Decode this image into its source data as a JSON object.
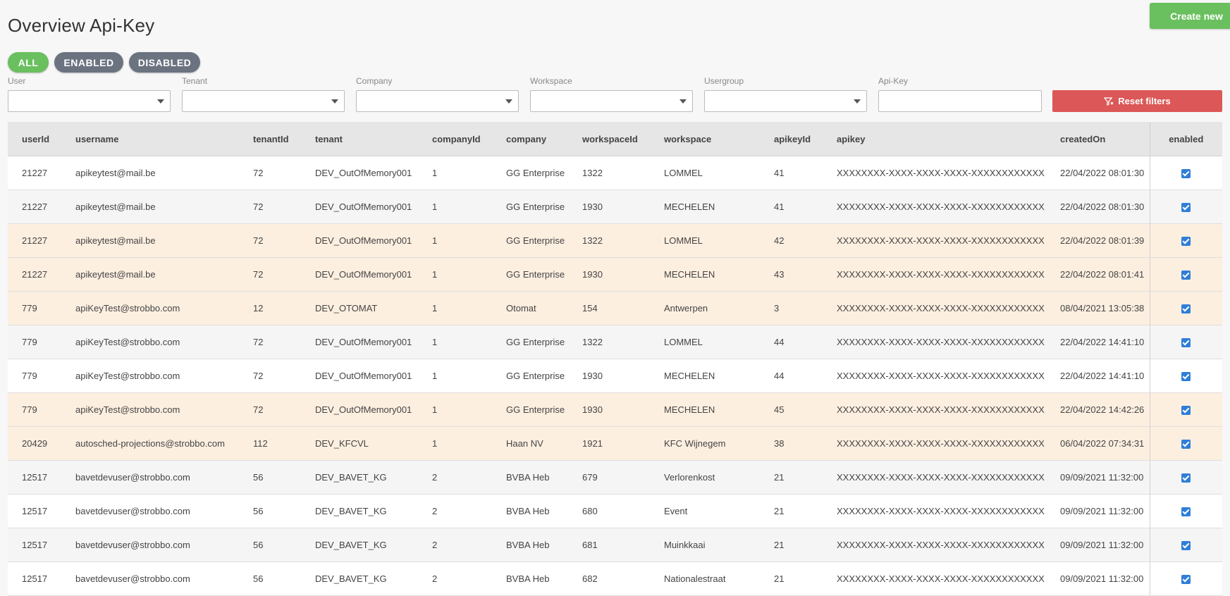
{
  "header": {
    "title": "Overview Api-Key",
    "create_label": "Create new"
  },
  "status_filters": {
    "all": "ALL",
    "enabled": "ENABLED",
    "disabled": "DISABLED"
  },
  "filters": {
    "user": {
      "label": "User",
      "value": ""
    },
    "tenant": {
      "label": "Tenant",
      "value": ""
    },
    "company": {
      "label": "Company",
      "value": ""
    },
    "workspace": {
      "label": "Workspace",
      "value": ""
    },
    "usergroup": {
      "label": "Usergroup",
      "value": ""
    },
    "apikey": {
      "label": "Api-Key",
      "value": ""
    },
    "reset_label": "Reset filters"
  },
  "table": {
    "columns": [
      "userId",
      "username",
      "tenantId",
      "tenant",
      "companyId",
      "company",
      "workspaceId",
      "workspace",
      "apikeyId",
      "apikey",
      "createdOn",
      "enabled"
    ],
    "rows": [
      {
        "userId": "21227",
        "username": "apikeytest@mail.be",
        "tenantId": "72",
        "tenant": "DEV_OutOfMemory001",
        "companyId": "1",
        "company": "GG Enterprise",
        "workspaceId": "1322",
        "workspace": "LOMMEL",
        "apikeyId": "41",
        "apikey": "XXXXXXXX-XXXX-XXXX-XXXX-XXXXXXXXXXXX",
        "createdOn": "22/04/2022 08:01:30",
        "enabled": true,
        "style": "plain"
      },
      {
        "userId": "21227",
        "username": "apikeytest@mail.be",
        "tenantId": "72",
        "tenant": "DEV_OutOfMemory001",
        "companyId": "1",
        "company": "GG Enterprise",
        "workspaceId": "1930",
        "workspace": "MECHELEN",
        "apikeyId": "41",
        "apikey": "XXXXXXXX-XXXX-XXXX-XXXX-XXXXXXXXXXXX",
        "createdOn": "22/04/2022 08:01:30",
        "enabled": true,
        "style": "alt"
      },
      {
        "userId": "21227",
        "username": "apikeytest@mail.be",
        "tenantId": "72",
        "tenant": "DEV_OutOfMemory001",
        "companyId": "1",
        "company": "GG Enterprise",
        "workspaceId": "1322",
        "workspace": "LOMMEL",
        "apikeyId": "42",
        "apikey": "XXXXXXXX-XXXX-XXXX-XXXX-XXXXXXXXXXXX",
        "createdOn": "22/04/2022 08:01:39",
        "enabled": true,
        "style": "hl"
      },
      {
        "userId": "21227",
        "username": "apikeytest@mail.be",
        "tenantId": "72",
        "tenant": "DEV_OutOfMemory001",
        "companyId": "1",
        "company": "GG Enterprise",
        "workspaceId": "1930",
        "workspace": "MECHELEN",
        "apikeyId": "43",
        "apikey": "XXXXXXXX-XXXX-XXXX-XXXX-XXXXXXXXXXXX",
        "createdOn": "22/04/2022 08:01:41",
        "enabled": true,
        "style": "hl"
      },
      {
        "userId": "779",
        "username": "apiKeyTest@strobbo.com",
        "tenantId": "12",
        "tenant": "DEV_OTOMAT",
        "companyId": "1",
        "company": "Otomat",
        "workspaceId": "154",
        "workspace": "Antwerpen",
        "apikeyId": "3",
        "apikey": "XXXXXXXX-XXXX-XXXX-XXXX-XXXXXXXXXXXX",
        "createdOn": "08/04/2021 13:05:38",
        "enabled": true,
        "style": "hl"
      },
      {
        "userId": "779",
        "username": "apiKeyTest@strobbo.com",
        "tenantId": "72",
        "tenant": "DEV_OutOfMemory001",
        "companyId": "1",
        "company": "GG Enterprise",
        "workspaceId": "1322",
        "workspace": "LOMMEL",
        "apikeyId": "44",
        "apikey": "XXXXXXXX-XXXX-XXXX-XXXX-XXXXXXXXXXXX",
        "createdOn": "22/04/2022 14:41:10",
        "enabled": true,
        "style": "alt"
      },
      {
        "userId": "779",
        "username": "apiKeyTest@strobbo.com",
        "tenantId": "72",
        "tenant": "DEV_OutOfMemory001",
        "companyId": "1",
        "company": "GG Enterprise",
        "workspaceId": "1930",
        "workspace": "MECHELEN",
        "apikeyId": "44",
        "apikey": "XXXXXXXX-XXXX-XXXX-XXXX-XXXXXXXXXXXX",
        "createdOn": "22/04/2022 14:41:10",
        "enabled": true,
        "style": "plain"
      },
      {
        "userId": "779",
        "username": "apiKeyTest@strobbo.com",
        "tenantId": "72",
        "tenant": "DEV_OutOfMemory001",
        "companyId": "1",
        "company": "GG Enterprise",
        "workspaceId": "1930",
        "workspace": "MECHELEN",
        "apikeyId": "45",
        "apikey": "XXXXXXXX-XXXX-XXXX-XXXX-XXXXXXXXXXXX",
        "createdOn": "22/04/2022 14:42:26",
        "enabled": true,
        "style": "hl"
      },
      {
        "userId": "20429",
        "username": "autosched-projections@strobbo.com",
        "tenantId": "112",
        "tenant": "DEV_KFCVL",
        "companyId": "1",
        "company": "Haan NV",
        "workspaceId": "1921",
        "workspace": "KFC Wijnegem",
        "apikeyId": "38",
        "apikey": "XXXXXXXX-XXXX-XXXX-XXXX-XXXXXXXXXXXX",
        "createdOn": "06/04/2022 07:34:31",
        "enabled": true,
        "style": "hl"
      },
      {
        "userId": "12517",
        "username": "bavetdevuser@strobbo.com",
        "tenantId": "56",
        "tenant": "DEV_BAVET_KG",
        "companyId": "2",
        "company": "BVBA Heb",
        "workspaceId": "679",
        "workspace": "Verlorenkost",
        "apikeyId": "21",
        "apikey": "XXXXXXXX-XXXX-XXXX-XXXX-XXXXXXXXXXXX",
        "createdOn": "09/09/2021 11:32:00",
        "enabled": true,
        "style": "alt"
      },
      {
        "userId": "12517",
        "username": "bavetdevuser@strobbo.com",
        "tenantId": "56",
        "tenant": "DEV_BAVET_KG",
        "companyId": "2",
        "company": "BVBA Heb",
        "workspaceId": "680",
        "workspace": "Event",
        "apikeyId": "21",
        "apikey": "XXXXXXXX-XXXX-XXXX-XXXX-XXXXXXXXXXXX",
        "createdOn": "09/09/2021 11:32:00",
        "enabled": true,
        "style": "plain"
      },
      {
        "userId": "12517",
        "username": "bavetdevuser@strobbo.com",
        "tenantId": "56",
        "tenant": "DEV_BAVET_KG",
        "companyId": "2",
        "company": "BVBA Heb",
        "workspaceId": "681",
        "workspace": "Muinkkaai",
        "apikeyId": "21",
        "apikey": "XXXXXXXX-XXXX-XXXX-XXXX-XXXXXXXXXXXX",
        "createdOn": "09/09/2021 11:32:00",
        "enabled": true,
        "style": "alt"
      },
      {
        "userId": "12517",
        "username": "bavetdevuser@strobbo.com",
        "tenantId": "56",
        "tenant": "DEV_BAVET_KG",
        "companyId": "2",
        "company": "BVBA Heb",
        "workspaceId": "682",
        "workspace": "Nationalestraat",
        "apikeyId": "21",
        "apikey": "XXXXXXXX-XXXX-XXXX-XXXX-XXXXXXXXXXXX",
        "createdOn": "09/09/2021 11:32:00",
        "enabled": true,
        "style": "plain"
      }
    ]
  },
  "colors": {
    "accent_green": "#6abf5e",
    "pill_gray": "#6b7280",
    "danger_red": "#dc5757",
    "highlight_row": "#fdefe0",
    "checkbox_blue": "#2f7ed8"
  },
  "icons": {
    "reset": "filter-clear-icon",
    "dropdown": "chevron-down-icon",
    "checkbox": "checkbox-checked-icon"
  }
}
